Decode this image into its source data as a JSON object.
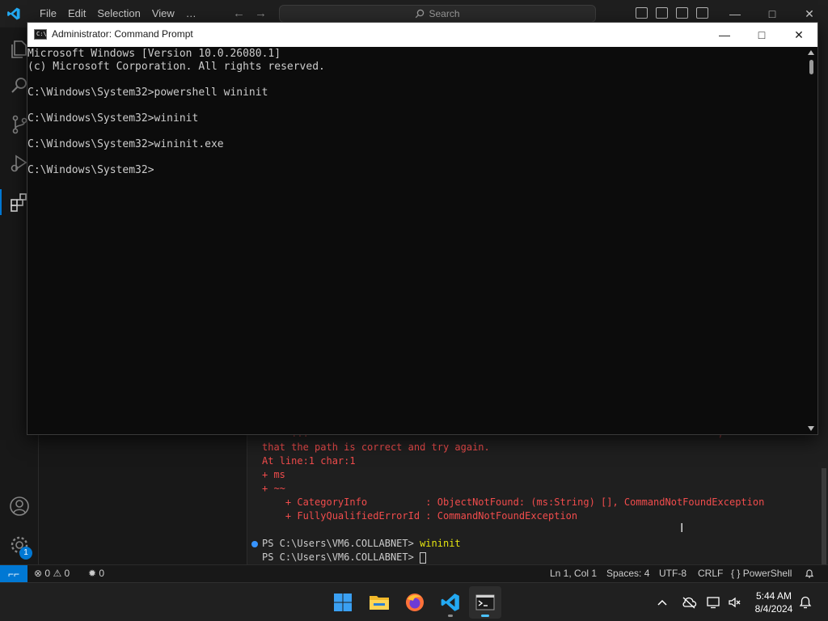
{
  "vscode": {
    "menu": [
      "File",
      "Edit",
      "Selection",
      "View",
      "…"
    ],
    "search_placeholder": "Search",
    "terminal": {
      "partial_line": "  ~~ ...~~~ ~~~~ ~~~ ~~~ ~~~~~~ ~~ ~~~ ~~~ ~~~~ ~~ ~~~~ ~~ ~ ~~~~ ~~~ ~~~~~~~~, ~~~~~~",
      "err_line1": "that the path is correct and try again.",
      "err_line2": "At line:1 char:1",
      "err_line3": "+ ms",
      "err_line4": "+ ~~",
      "err_category": "    + CategoryInfo          : ObjectNotFound: (ms:String) [], CommandNotFoundException",
      "err_fqid": "    + FullyQualifiedErrorId : CommandNotFoundException",
      "prompt1": "PS C:\\Users\\VM6.COLLABNET> ",
      "cmd1": "wininit",
      "prompt2": "PS C:\\Users\\VM6.COLLABNET> "
    },
    "statusbar": {
      "errors": "0",
      "warnings": "0",
      "ports": "0",
      "position": "Ln 1, Col 1",
      "spaces": "Spaces: 4",
      "encoding": "UTF-8",
      "eol": "CRLF",
      "language": "PowerShell"
    },
    "settings_badge": "1"
  },
  "cmd": {
    "title": "Administrator: Command Prompt",
    "icon_text": "C:\\",
    "lines": [
      "Microsoft Windows [Version 10.0.26080.1]",
      "(c) Microsoft Corporation. All rights reserved.",
      "",
      "C:\\Windows\\System32>powershell wininit",
      "",
      "C:\\Windows\\System32>wininit",
      "",
      "C:\\Windows\\System32>wininit.exe",
      "",
      "C:\\Windows\\System32>"
    ]
  },
  "taskbar": {
    "apps": [
      "start",
      "file-explorer",
      "firefox",
      "vscode",
      "terminal"
    ],
    "time": "5:44 AM",
    "date": "8/4/2024"
  }
}
